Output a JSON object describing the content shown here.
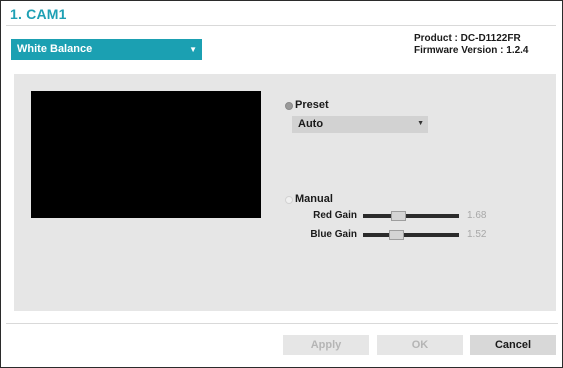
{
  "window": {
    "title": "1. CAM1"
  },
  "menu": {
    "selected": "White Balance",
    "arrow_icon": "caret-down-icon"
  },
  "device_info": {
    "product": "Product : DC-D1122FR",
    "firmware": "Firmware Version : 1.2.4"
  },
  "preset": {
    "label": "Preset",
    "selected_value": "Auto",
    "checked": true
  },
  "manual": {
    "label": "Manual",
    "checked": false,
    "red_gain": {
      "label": "Red Gain",
      "value": "1.68",
      "fraction": 0.35
    },
    "blue_gain": {
      "label": "Blue Gain",
      "value": "1.52",
      "fraction": 0.32
    }
  },
  "buttons": {
    "apply": "Apply",
    "ok": "OK",
    "cancel": "Cancel"
  },
  "colors": {
    "accent": "#1ba0b2",
    "title": "#1ea0b4",
    "panel": "#e6e6e6"
  }
}
